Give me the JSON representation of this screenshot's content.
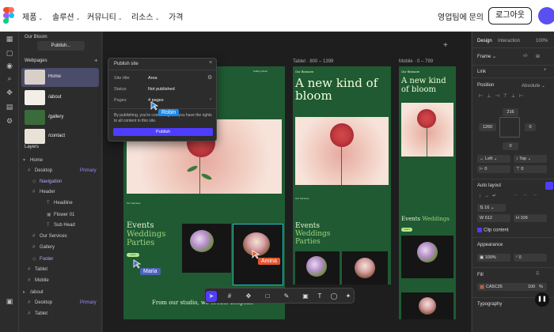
{
  "nav": {
    "items": [
      "제품",
      "솔루션",
      "커뮤니티",
      "리소스",
      "가격"
    ],
    "contact": "영업팀에 문의",
    "logout": "로그아웃"
  },
  "left_panel": {
    "project": "Our Bloom",
    "publish": "Publish...",
    "webpages_label": "Webpages",
    "pages": [
      "Home",
      "/about",
      "/gallery",
      "/contact"
    ],
    "layers_label": "Layers",
    "layers": [
      {
        "label": "Home",
        "badge": ""
      },
      {
        "label": "Desktop",
        "badge": "Primary"
      },
      {
        "label": "Navigation",
        "badge": ""
      },
      {
        "label": "Header",
        "badge": ""
      },
      {
        "label": "Headline",
        "badge": ""
      },
      {
        "label": "Flower 01",
        "badge": ""
      },
      {
        "label": "Sub Head",
        "badge": ""
      },
      {
        "label": "Our Services",
        "badge": ""
      },
      {
        "label": "Gallery",
        "badge": ""
      },
      {
        "label": "Footer",
        "badge": ""
      },
      {
        "label": "Tablet",
        "badge": ""
      },
      {
        "label": "Mobile",
        "badge": ""
      },
      {
        "label": "/about",
        "badge": ""
      },
      {
        "label": "Desktop",
        "badge": "Primary"
      },
      {
        "label": "Tablet",
        "badge": ""
      }
    ]
  },
  "publish_popover": {
    "title": "Publish site",
    "site_title_label": "Site title",
    "site_title_value": "Area",
    "status_label": "Status",
    "status_value": "Not published",
    "pages_label": "Pages",
    "pages_value": "4 pages",
    "note": "By publishing, you're confirming that you have the rights to all content in this site.",
    "button": "Publish"
  },
  "canvas": {
    "tablet_label": "Tablet · 800 – 1399",
    "mobile_label": "Mobile · 0 – 799",
    "brand": "Our Blossom",
    "headline": "A new kind of bloom",
    "services": "Our Services",
    "events": "Events",
    "weddings": "Weddings",
    "parties": "Parties",
    "bottom_text": "From our studio, we create bespoke",
    "menu": [
      "Gallery",
      "About",
      "Contact"
    ],
    "learn": "Learn"
  },
  "cursors": [
    {
      "name": "Robin",
      "color": "#1e88e5"
    },
    {
      "name": "Maria",
      "color": "#4b63b8"
    },
    {
      "name": "Amina",
      "color": "#e4572e"
    }
  ],
  "right_panel": {
    "tabs": [
      "Design",
      "Interaction"
    ],
    "zoom": "100%",
    "frame": "Frame",
    "link": "Link",
    "position": "Position",
    "position_mode": "Absolute",
    "top_val": "216",
    "left_val": "1260",
    "pin_left": "Left",
    "pin_top": "Top",
    "offset_left": "0",
    "offset_top": "0",
    "auto_layout": "Auto layout",
    "gap": "16",
    "w": "612",
    "h": "109",
    "clip": "Clip content",
    "appearance": "Appearance",
    "opacity": "100%",
    "radius": "0",
    "fill": "Fill",
    "fill_hex": "CA5C35",
    "fill_opacity": "100",
    "fill_pct": "%",
    "typography": "Typography"
  }
}
